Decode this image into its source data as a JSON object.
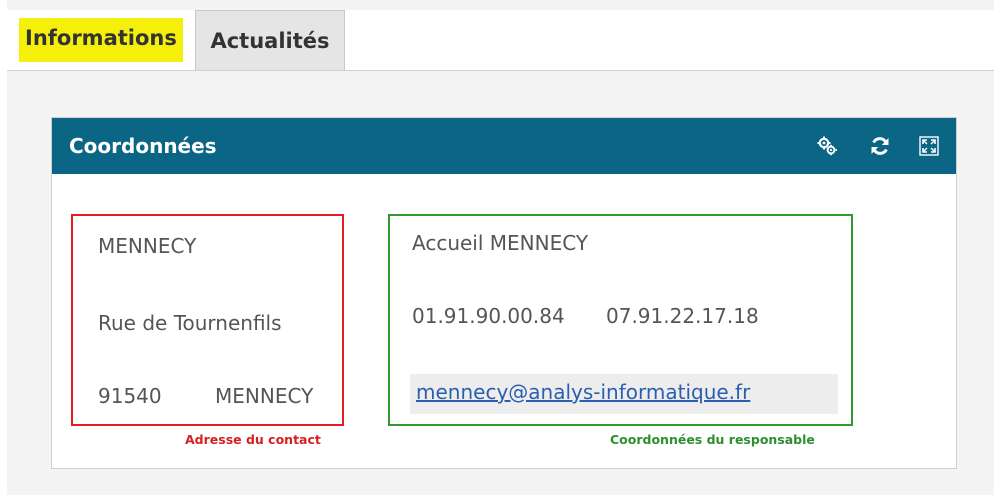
{
  "tabs": [
    {
      "label": "Informations",
      "active": true,
      "highlight": "#f4f00a"
    },
    {
      "label": "Actualités",
      "active": false
    }
  ],
  "panel": {
    "title": "Coordonnées",
    "header_color": "#0b6585",
    "icons": [
      "settings-gears-icon",
      "refresh-icon",
      "expand-icon"
    ]
  },
  "contact_address": {
    "city": "MENNECY",
    "street": "Rue de Tournenfils",
    "postal_code": "91540",
    "postal_city": "MENNECY",
    "caption": "Adresse du contact",
    "border_color": "#e21e1e"
  },
  "responsible": {
    "name": "Accueil MENNECY",
    "phone1": "01.91.90.00.84",
    "phone2": "07.91.22.17.18",
    "email": "mennecy@analys-informatique.fr",
    "caption": "Coordonnées du responsable",
    "border_color": "#2f9a2f"
  }
}
